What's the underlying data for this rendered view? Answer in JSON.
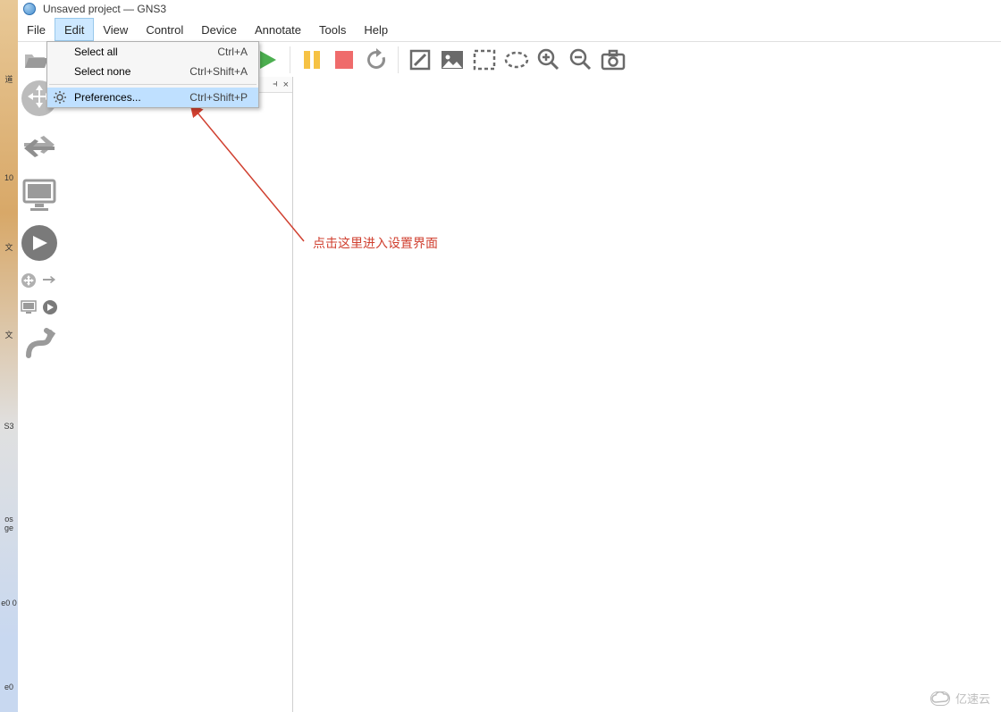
{
  "window": {
    "title": "Unsaved project — GNS3"
  },
  "menubar": {
    "items": [
      {
        "label": "File"
      },
      {
        "label": "Edit",
        "open": true
      },
      {
        "label": "View"
      },
      {
        "label": "Control"
      },
      {
        "label": "Device"
      },
      {
        "label": "Annotate"
      },
      {
        "label": "Tools"
      },
      {
        "label": "Help"
      }
    ]
  },
  "edit_menu": {
    "items": [
      {
        "label": "Select all",
        "shortcut": "Ctrl+A",
        "highlight": false
      },
      {
        "label": "Select none",
        "shortcut": "Ctrl+Shift+A",
        "highlight": false
      }
    ],
    "preferences": {
      "label": "Preferences...",
      "shortcut": "Ctrl+Shift+P",
      "highlight": true
    }
  },
  "toolbar": {
    "open_icon": "open-folder",
    "play_icon": "play",
    "pause_icon": "pause",
    "stop_icon": "stop",
    "reload_icon": "reload",
    "note_icon": "note",
    "image_icon": "image",
    "rect_icon": "rect-select",
    "ellipse_icon": "ellipse-select",
    "zoomin_icon": "zoom-in",
    "zoomout_icon": "zoom-out",
    "screenshot_icon": "screenshot"
  },
  "left_toolbar": {
    "routers_icon": "router",
    "switches_icon": "switch",
    "end_devices_icon": "monitor",
    "security_icon": "round-next",
    "all_devices_icon": "all-devices",
    "link_icon": "cable"
  },
  "side_panel": {
    "dock_symbol": "⫞",
    "close_symbol": "×"
  },
  "annotation_text": "点击这里进入设置界面",
  "watermark_text": "亿速云",
  "desktop_labels": {
    "a": "道",
    "b": "10",
    "c": "文",
    "d": "文",
    "e": "S3",
    "f": "os ge",
    "g": "e0 0",
    "h": "e0"
  }
}
